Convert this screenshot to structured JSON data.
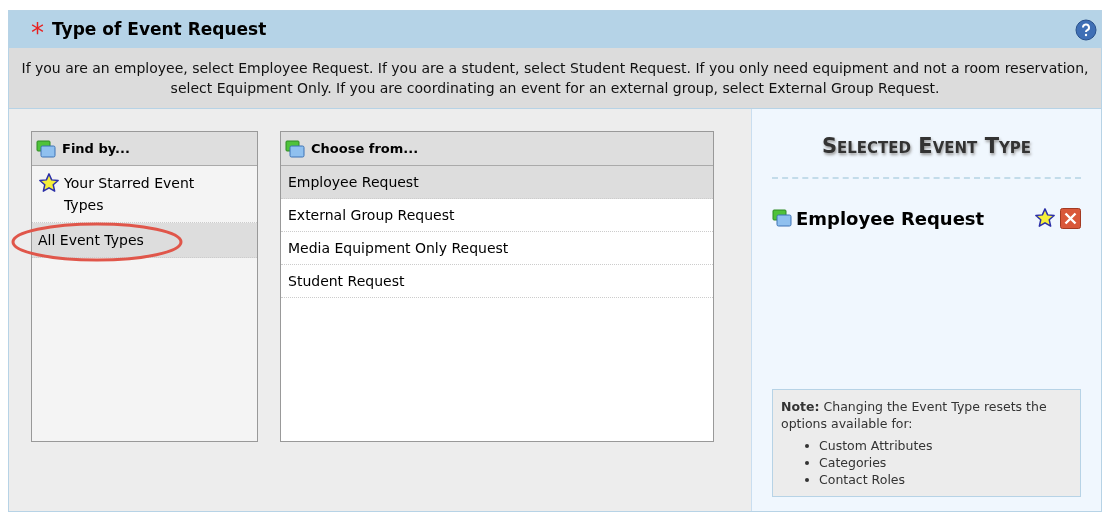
{
  "header": {
    "required_mark": "*",
    "title": "Type of Event Request"
  },
  "instructions": "If you are an employee, select Employee Request. If you are a student, select Student Request. If you only need equipment and not a room reservation, select Equipment Only. If you are coordinating an event for an external group, select External Group Request.",
  "find_by": {
    "title": "Find by...",
    "items": [
      {
        "label": "Your Starred Event Types",
        "kind": "starred",
        "selected": false
      },
      {
        "label": "All Event Types",
        "kind": "plain",
        "selected": true,
        "circled": true
      }
    ]
  },
  "choose_from": {
    "title": "Choose from...",
    "items": [
      {
        "label": "Employee Request",
        "selected": true
      },
      {
        "label": "External Group Request",
        "selected": false
      },
      {
        "label": "Media Equipment Only Request",
        "selected": false
      },
      {
        "label": "Student Request",
        "selected": false
      }
    ]
  },
  "selected_panel": {
    "title": "Selected Event Type",
    "event": "Employee Request",
    "note": {
      "lead": "Note:",
      "text": "Changing the Event Type resets the options available for:",
      "items": [
        "Custom Attributes",
        "Categories",
        "Contact Roles"
      ]
    }
  }
}
